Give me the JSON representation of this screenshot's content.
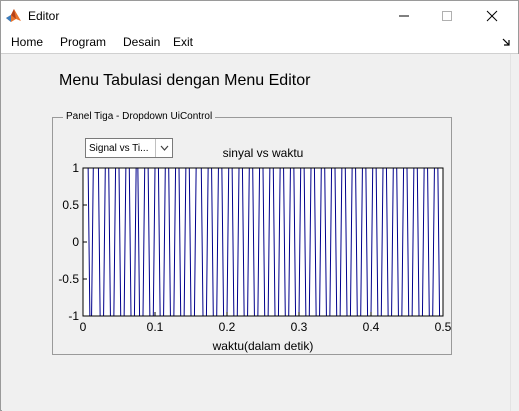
{
  "window": {
    "title": "Editor",
    "minimize_icon": "minimize-icon",
    "maximize_icon": "maximize-icon",
    "close_icon": "close-icon"
  },
  "menu": {
    "items": [
      {
        "label": "Home"
      },
      {
        "label": "Program"
      },
      {
        "label": "Desain"
      },
      {
        "label": "Exit"
      }
    ]
  },
  "content": {
    "heading": "Menu Tabulasi dengan Menu Editor",
    "panel_title": "Panel Tiga - Dropdown UiControl",
    "dropdown_value": "Signal vs Ti..."
  },
  "colors": {
    "line": "#00008b",
    "window_bg": "#f0f0f0",
    "axes_bg": "#ffffff"
  },
  "chart_data": {
    "type": "line",
    "title": "sinyal vs waktu",
    "xlabel": "waktu(dalam detik)",
    "ylabel": "",
    "xlim": [
      0,
      0.5
    ],
    "ylim": [
      -1,
      1
    ],
    "x_ticks": [
      "0",
      "0.1",
      "0.2",
      "0.3",
      "0.4",
      "0.5"
    ],
    "y_ticks": [
      "1",
      "0.5",
      "0",
      "-0.5",
      "-1"
    ],
    "series": [
      {
        "signal": "square",
        "frequency_hz": 70,
        "amplitude": 1,
        "x_range": [
          0,
          0.5
        ]
      }
    ],
    "grid": false,
    "box": true
  }
}
